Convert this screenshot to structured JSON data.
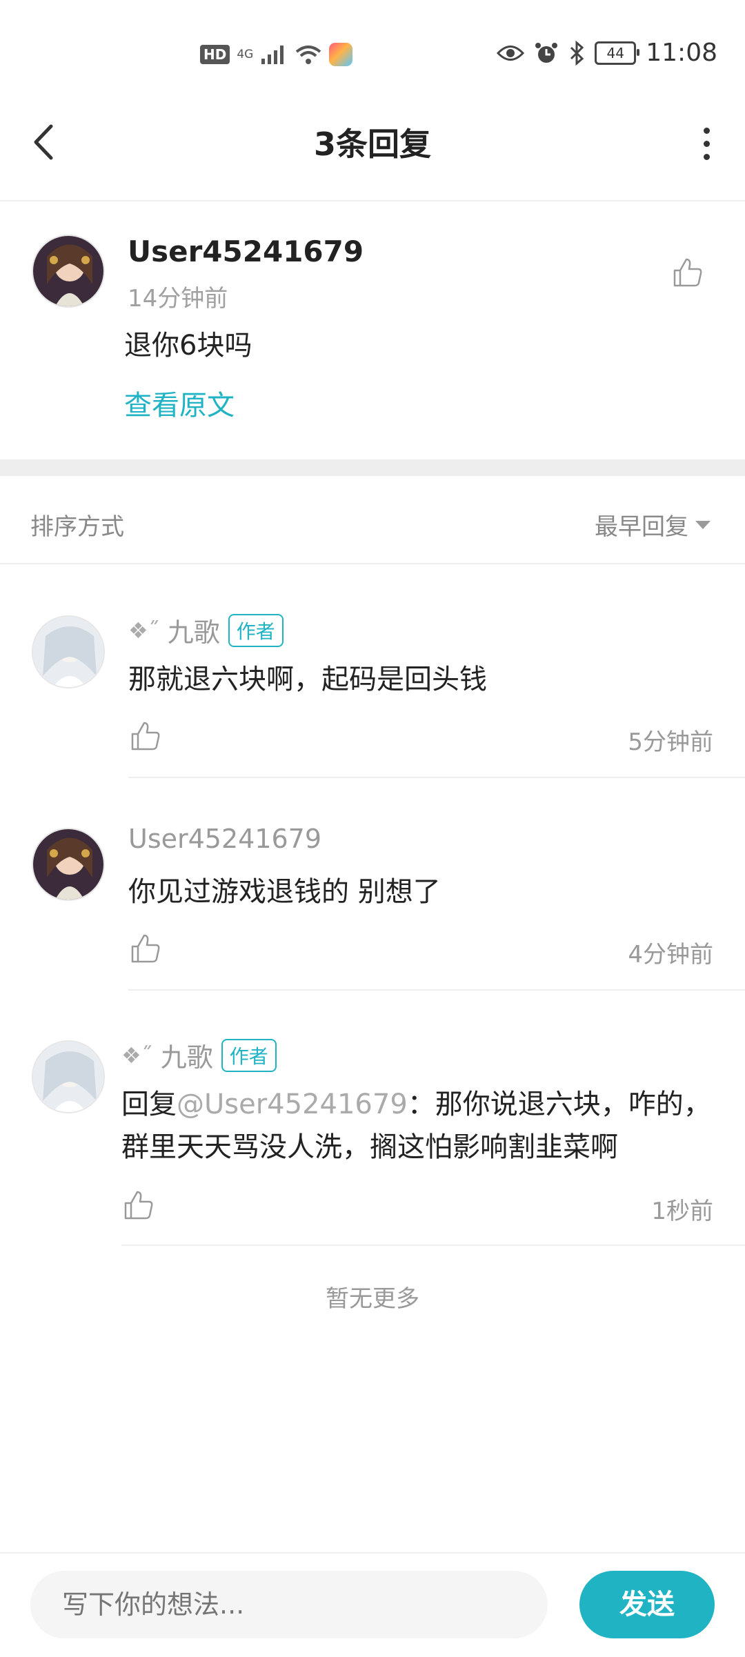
{
  "status_bar": {
    "hd": "HD",
    "network": "4G",
    "battery": "44",
    "time": "11:08"
  },
  "header": {
    "title": "3条回复"
  },
  "main_comment": {
    "username": "User45241679",
    "time": "14分钟前",
    "text": "退你6块吗",
    "view_original": "查看原文"
  },
  "sort": {
    "label": "排序方式",
    "value": "最早回复"
  },
  "replies": [
    {
      "name_prefix": "❖˝",
      "name": "九歌",
      "tag": "作者",
      "text": "那就退六块啊，起码是回头钱",
      "time": "5分钟前"
    },
    {
      "name": "User45241679",
      "text": "你见过游戏退钱的 别想了",
      "time": "4分钟前"
    },
    {
      "name_prefix": "❖˝",
      "name": "九歌",
      "tag": "作者",
      "reply_prefix": "回复",
      "mention": "@User45241679",
      "text": "：那你说退六块，咋的，群里天天骂没人洗，搁这怕影响割韭菜啊",
      "time": "1秒前"
    }
  ],
  "footer_note": "暂无更多",
  "composer": {
    "placeholder": "写下你的想法...",
    "send_label": "发送"
  },
  "colors": {
    "accent": "#1fb3c4",
    "muted_text": "#999999",
    "divider": "#eeeeee"
  }
}
